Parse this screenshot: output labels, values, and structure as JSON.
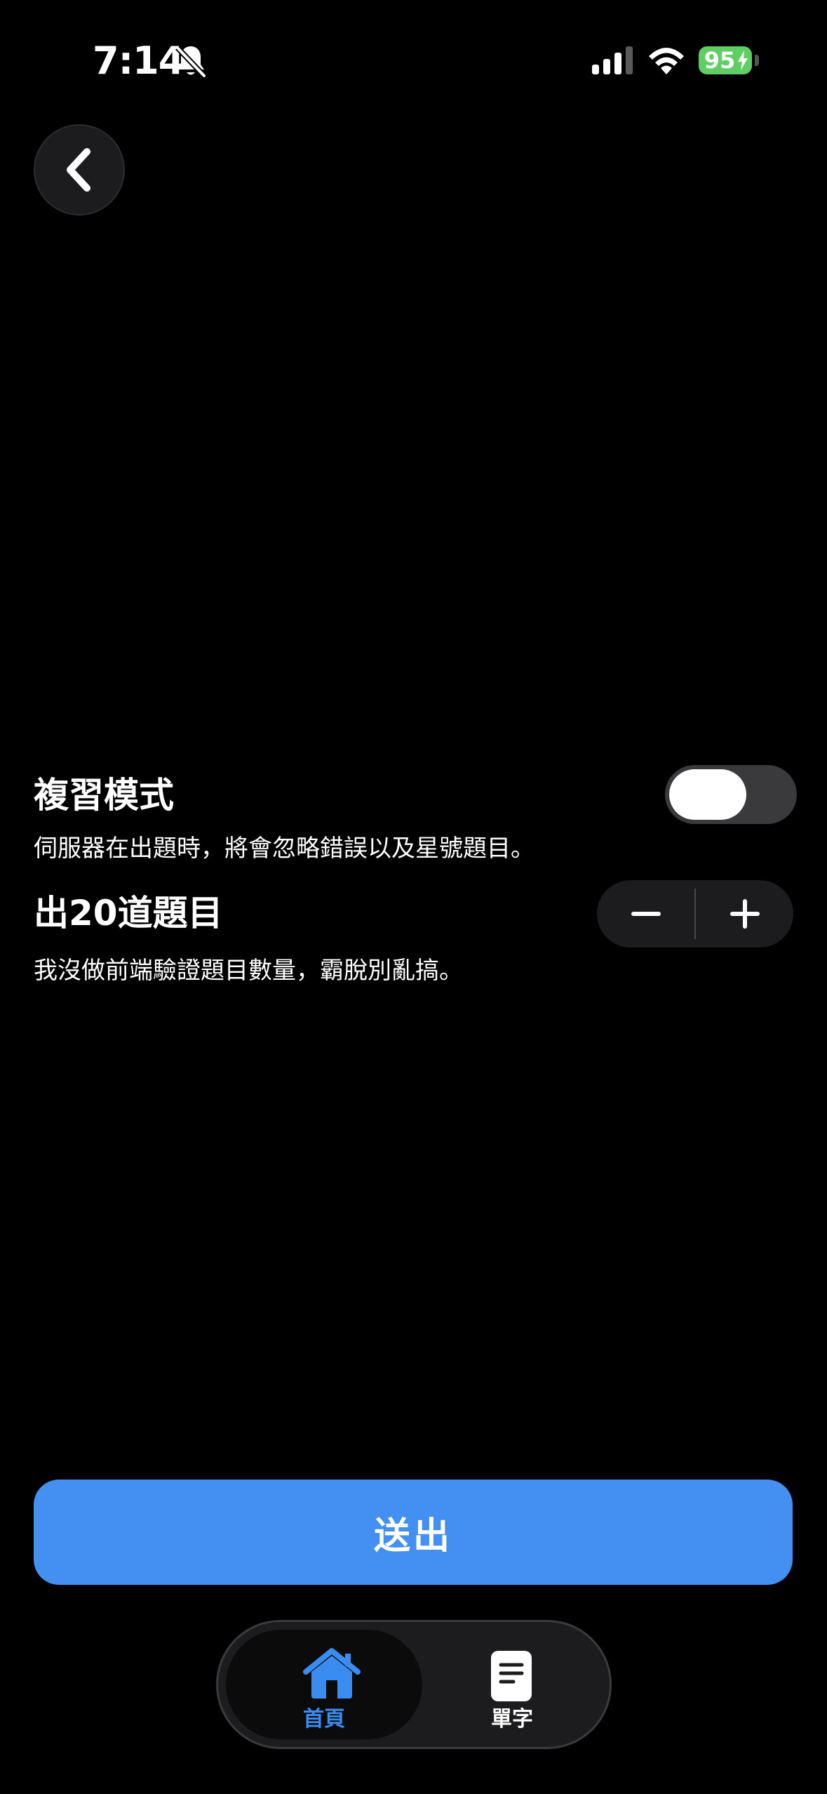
{
  "status_bar": {
    "time": "7:14",
    "battery_percent": "95",
    "icons": [
      "bell-slash-icon",
      "cellular-signal-icon",
      "wifi-icon",
      "battery-charging-icon"
    ],
    "battery_color": "#5fcf65"
  },
  "navigation": {
    "back_icon": "chevron-left-icon"
  },
  "review_mode": {
    "title": "複習模式",
    "description": "伺服器在出題時，將會忽略錯誤以及星號題目。",
    "enabled": false
  },
  "question_count": {
    "title": "出20道題目",
    "value": 20,
    "description": "我沒做前端驗證題目數量，霸脫別亂搞。",
    "decrement_icon": "minus-icon",
    "increment_icon": "plus-icon"
  },
  "submit": {
    "label": "送出",
    "color": "#4390f2"
  },
  "tab_bar": {
    "tabs": [
      {
        "label": "首頁",
        "icon": "house-icon",
        "active": true,
        "color": "#3b8cf0"
      },
      {
        "label": "單字",
        "icon": "document-icon",
        "active": false,
        "color": "#ffffff"
      }
    ]
  }
}
